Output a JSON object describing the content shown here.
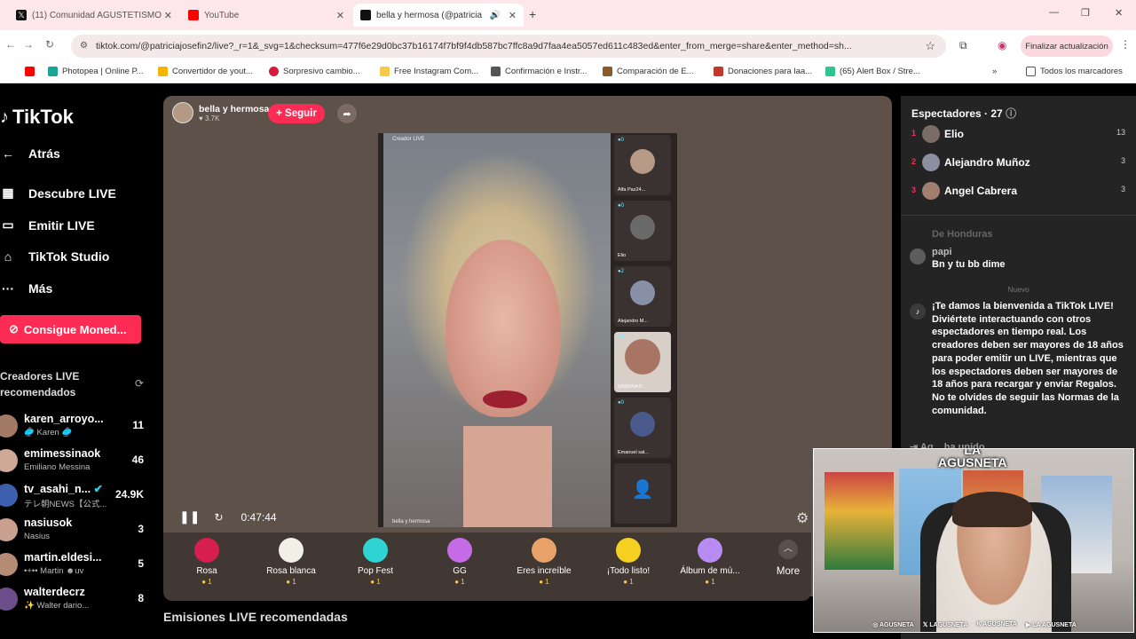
{
  "browser": {
    "tabs": [
      {
        "title": "(11) Comunidad AGUSTETISMO",
        "favicon_color": "#111111"
      },
      {
        "title": "YouTube",
        "favicon_color": "#ff0000"
      },
      {
        "title": "bella y hermosa (@patricia",
        "favicon_color": "#111111",
        "active": true
      }
    ],
    "new_tab": "+",
    "url": "tiktok.com/@patriciajosefin2/live?_r=1&_svg=1&checksum=477f6e29d0bc37b16174f7bf9f4db587bc7ffc8a9d7faa4ea5057ed611c483ed&enter_from_merge=share&enter_method=sh...",
    "update_button": "Finalizar actualización",
    "bookmarks": [
      {
        "label": "Photopea | Online P...",
        "color": "#18a497"
      },
      {
        "label": "Convertidor de yout...",
        "color": "#f4b400"
      },
      {
        "label": "Sorpresivo cambio...",
        "color": "#d81b3c"
      },
      {
        "label": "Free Instagram Com...",
        "color": "#f7c948"
      },
      {
        "label": "Confirmación e Instr...",
        "color": "#555555"
      },
      {
        "label": "Comparación de E...",
        "color": "#8b5a2b"
      },
      {
        "label": "Donaciones para laa...",
        "color": "#c0392b"
      },
      {
        "label": "(65) Alert Box / Stre...",
        "color": "#31c48d"
      }
    ],
    "all_bookmarks": "Todos los marcadores"
  },
  "sidebar": {
    "logo": "TikTok",
    "back": "Atrás",
    "nav": [
      "Descubre LIVE",
      "Emitir LIVE",
      "TikTok Studio",
      "Más"
    ],
    "coins_button": "Consigue Moned...",
    "recommended_title_line1": "Creadores LIVE",
    "recommended_title_line2": "recomendados",
    "creators": [
      {
        "name": "karen_arroyo...",
        "sub": "🥏 Karen 🥏",
        "count": "11"
      },
      {
        "name": "emimessinaok",
        "sub": "Emiliano Messina",
        "count": "46"
      },
      {
        "name": "tv_asahi_n...",
        "sub": "テレ朝NEWS【公式...",
        "count": "24.9K"
      },
      {
        "name": "nasiusok",
        "sub": "Nasius",
        "count": "3"
      },
      {
        "name": "martin.eldesi...",
        "sub": "•+•• Martin ☻uv",
        "count": "5"
      },
      {
        "name": "walterdecrz",
        "sub": "✨ Walter dario...",
        "count": "8"
      }
    ]
  },
  "live": {
    "host_name": "bella y hermosa",
    "host_likes": "♥ 3.7K",
    "follow_button": "+ Seguir",
    "video_label": "Creador LIVE",
    "video_footer": "bella y hermosa",
    "guests": [
      "Alfa Paz24...",
      "Elio",
      "Alejandro M...",
      "SANDRA P...",
      "Emanuel sal...",
      ""
    ],
    "time": "0:47:44",
    "gifts": [
      {
        "name": "Rosa",
        "price": "1",
        "color": "#d61f4e"
      },
      {
        "name": "Rosa blanca",
        "price": "1",
        "color": "#f1efe6"
      },
      {
        "name": "Pop Fest",
        "price": "1",
        "color": "#2fd3d1"
      },
      {
        "name": "GG",
        "price": "1",
        "color": "#c46be6"
      },
      {
        "name": "Eres increíble",
        "price": "1",
        "color": "#e9a36a"
      },
      {
        "name": "¡Todo listo!",
        "price": "1",
        "color": "#f5d020"
      },
      {
        "name": "Álbum de mú...",
        "price": "1",
        "color": "#b88cf2"
      }
    ],
    "more": "More",
    "recommended_streams": "Emisiones LIVE recomendadas"
  },
  "chat": {
    "viewers_title": "Espectadores · 27",
    "viewers": [
      {
        "rank": "1",
        "name": "Elio",
        "count": "13"
      },
      {
        "rank": "2",
        "name": "Alejandro Muñoz",
        "count": "3"
      },
      {
        "rank": "3",
        "name": "Angel Cabrera",
        "count": "3"
      }
    ],
    "faded_user": "De Honduras",
    "message_user": "papi",
    "message_text": "Bn y tu bb dime",
    "new_label": "Nuevo",
    "welcome_text": "¡Te damos la bienvenida a TikTok LIVE! Diviértete interactuando con otros espectadores en tiempo real. Los creadores deben ser mayores de 18 años para poder emitir un LIVE, mientras que los espectadores deben ser mayores de 18 años para recargar y enviar Regalos. No te olvides de seguir las Normas de la comunidad.",
    "joined_text": "Ag... ha unido"
  },
  "webcam": {
    "logo_line1": "LA",
    "logo_line2": "AGUSNETA",
    "socials": [
      "AGUSNETA",
      "LAGUSNETA",
      "AGUSNETA",
      "LA AGUSNETA"
    ]
  }
}
